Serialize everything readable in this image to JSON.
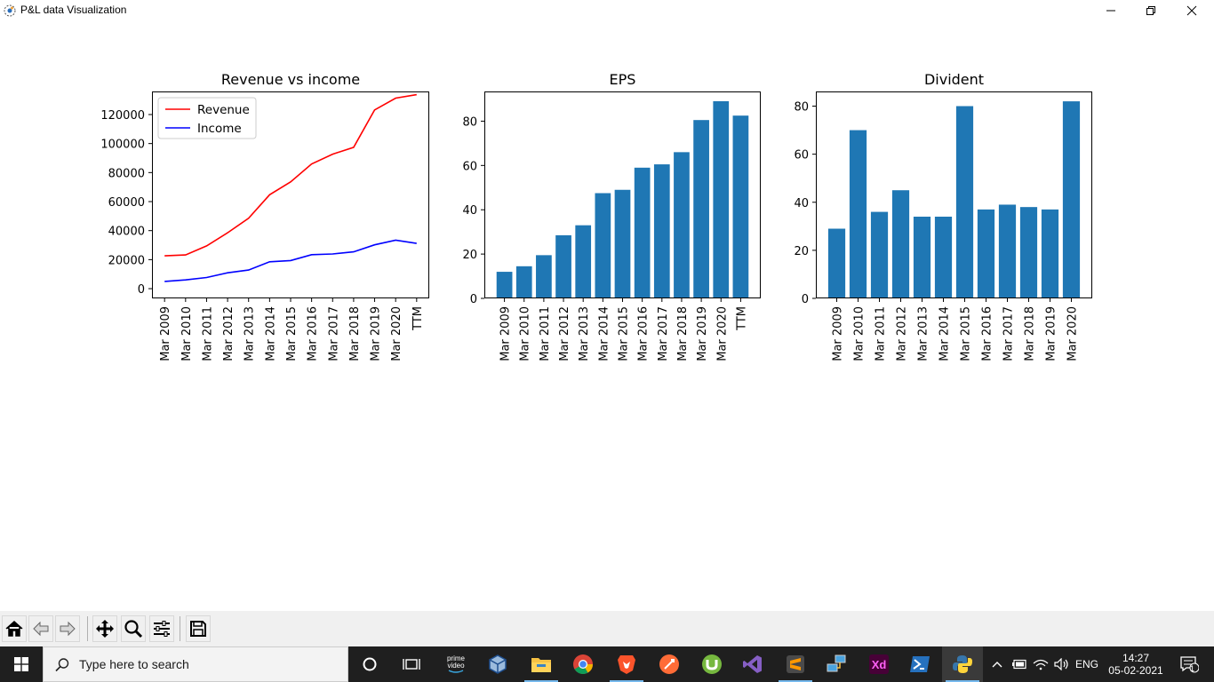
{
  "window": {
    "title": "P&L data Visualization",
    "controls": [
      "minimize",
      "restore",
      "close"
    ]
  },
  "figure": {
    "panels": [
      {
        "title": "Revenue vs income"
      },
      {
        "title": "EPS"
      },
      {
        "title": "Divident"
      }
    ]
  },
  "chart_data": [
    {
      "type": "line",
      "title": "Revenue vs income",
      "categories": [
        "Mar 2009",
        "Mar 2010",
        "Mar 2011",
        "Mar 2012",
        "Mar 2013",
        "Mar 2014",
        "Mar 2015",
        "Mar 2016",
        "Mar 2017",
        "Mar 2018",
        "Mar 2019",
        "Mar 2020",
        "TTM"
      ],
      "series": [
        {
          "name": "Revenue",
          "color": "#ff0000",
          "values": [
            22600,
            23200,
            29500,
            38500,
            48500,
            64700,
            73600,
            85900,
            92700,
            97400,
            123200,
            131300,
            133700
          ]
        },
        {
          "name": "Income",
          "color": "#0000ff",
          "values": [
            5000,
            6000,
            7700,
            10900,
            12800,
            18500,
            19400,
            23400,
            23900,
            25400,
            30200,
            33400,
            31200
          ]
        }
      ],
      "yticks": [
        0,
        20000,
        40000,
        60000,
        80000,
        100000,
        120000
      ],
      "ylim": [
        -6700,
        135900
      ],
      "legend": "upper left",
      "grid": false
    },
    {
      "type": "bar",
      "title": "EPS",
      "categories": [
        "Mar 2009",
        "Mar 2010",
        "Mar 2011",
        "Mar 2012",
        "Mar 2013",
        "Mar 2014",
        "Mar 2015",
        "Mar 2016",
        "Mar 2017",
        "Mar 2018",
        "Mar 2019",
        "Mar 2020",
        "TTM"
      ],
      "values": [
        12,
        14.5,
        19.5,
        28.5,
        33,
        47.5,
        49,
        59,
        60.5,
        66,
        80.5,
        89,
        82.5
      ],
      "yticks": [
        0,
        20,
        40,
        60,
        80
      ],
      "ylim": [
        0,
        93.4
      ],
      "color": "#1f77b4",
      "grid": false
    },
    {
      "type": "bar",
      "title": "Divident",
      "categories": [
        "Mar 2009",
        "Mar 2010",
        "Mar 2011",
        "Mar 2012",
        "Mar 2013",
        "Mar 2014",
        "Mar 2015",
        "Mar 2016",
        "Mar 2017",
        "Mar 2018",
        "Mar 2019",
        "Mar 2020"
      ],
      "values": [
        29,
        70,
        36,
        45,
        34,
        34,
        80,
        37,
        39,
        38,
        37,
        82
      ],
      "yticks": [
        0,
        20,
        40,
        60,
        80
      ],
      "ylim": [
        0,
        86.1
      ],
      "color": "#1f77b4",
      "grid": false
    }
  ],
  "toolbar": {
    "buttons": [
      "home-icon",
      "back-icon",
      "forward-icon",
      "pan-icon",
      "zoom-icon",
      "configure-subplots-icon",
      "save-icon"
    ]
  },
  "taskbar": {
    "search_placeholder": "Type here to search",
    "prime_label_1": "prime",
    "prime_label_2": "video",
    "xd_label": "Xd",
    "language": "ENG",
    "time": "14:27",
    "date": "05-02-2021",
    "notification_count": "1"
  }
}
